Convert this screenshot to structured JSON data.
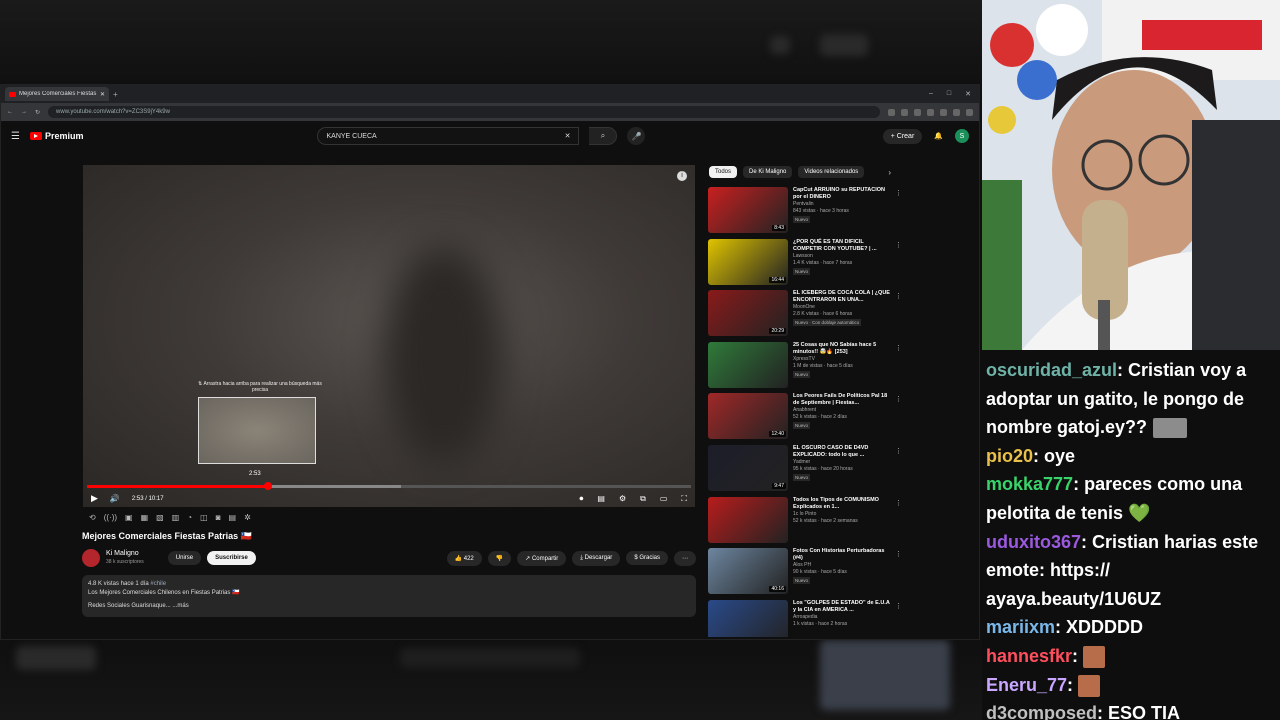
{
  "browser": {
    "tab_title": "Mejores Comerciales Fiestas Patrias",
    "url": "www.youtube.com/watch?v=ZC3S9jY4k9w",
    "window_controls": [
      "–",
      "□",
      "✕"
    ]
  },
  "youtube": {
    "logo_text": "Premium",
    "search_value": "KANYE CUECA",
    "create_label": "Crear",
    "avatar_letter": "S"
  },
  "player": {
    "seek_hint": "⇅ Arrastra hacia arriba para realizar una búsqueda más precisa",
    "preview_time": "2:53",
    "time_display": "2:53 / 10:17",
    "progress_fraction": 0.3,
    "buffered_fraction": 0.52
  },
  "video": {
    "title": "Mejores Comerciales Fiestas Patrias 🇨🇱",
    "channel": "Ki Maligno",
    "subscribers": "38 k suscriptores",
    "join_label": "Unirse",
    "subscribe_label": "Suscribirse",
    "likes": "422",
    "share_label": "Compartir",
    "download_label": "Descargar",
    "thanks_label": "Gracias",
    "desc_stats": "4.8 K vistas  hace 1 día",
    "desc_tag": "#chile",
    "desc_line1": "Los Mejores Comerciales Chilenos en Fiestas Patrias 🇨🇱",
    "desc_line2": "Redes Sociales Guarisnaque...",
    "desc_more": "...más"
  },
  "chips": [
    "Todos",
    "De Ki Maligno",
    "Videos relacionados"
  ],
  "recommendations": [
    {
      "title": "CapCut ARRUINO su REPUTACION por el DINERO",
      "channel": "Pentvalin",
      "meta": "843 vistas · hace 3 horas",
      "badge": "Nuevo",
      "duration": "8:43",
      "color": "#c92020"
    },
    {
      "title": "¿POR QUÉ ES TAN DIFICIL COMPETIR CON YOUTUBE? | ...",
      "channel": "Lawsson",
      "meta": "1.4 K vistas · hace 7 horas",
      "badge": "Nuevo",
      "duration": "16:44",
      "color": "#e0c400"
    },
    {
      "title": "EL ICEBERG DE COCA COLA | ¿QUE ENCONTRARON EN UNA...",
      "channel": "MoonOne",
      "meta": "2.8 K vistas · hace 6 horas",
      "badge": "Nuevo · Con doblaje automático",
      "duration": "20:29",
      "color": "#8a1a1a"
    },
    {
      "title": "25 Cosas que NO Sabías hace 5 minutos!! 🤯🔥 [253]",
      "channel": "XpressTV",
      "meta": "1 M de vistas · hace 5 días",
      "badge": "Nuevo",
      "duration": "",
      "color": "#2f7a3a"
    },
    {
      "title": "Los Peores Fails De Políticos Pal 18 de Septiembre | Fiestas...",
      "channel": "Anabhrent",
      "meta": "52 k vistas · hace 2 días",
      "badge": "Nuevo",
      "duration": "12:40",
      "color": "#a02828"
    },
    {
      "title": "EL OSCURO CASO DE D4VD EXPLICADO: todo lo que ...",
      "channel": "Yadmer",
      "meta": "95 k vistas · hace 20 horas",
      "badge": "Nuevo",
      "duration": "9:47",
      "color": "#1d1d2a"
    },
    {
      "title": "Todos los Tipos de COMUNISMO Explicados en 1...",
      "channel": "1c lo Pinto",
      "meta": "52 k vistas · hace 2 semanas",
      "badge": "",
      "duration": "",
      "color": "#b81c1c"
    },
    {
      "title": "Fotos Con Historias Perturbadoras (#4)",
      "channel": "Alos PH",
      "meta": "90 k vistas · hace 5 días",
      "badge": "Nuevo",
      "duration": "40:16",
      "color": "#6d86a0"
    },
    {
      "title": "Los \"GOLPES DE ESTADO\" de E.U.A y la CIA en AMERICA ...",
      "channel": "Arroapedia",
      "meta": "1 k vistas · hace 2 horas",
      "badge": "",
      "duration": "",
      "color": "#2a4a8a"
    }
  ],
  "chat": [
    {
      "user": "oscuridad_azul",
      "color": "#6fb3a8",
      "text": "Cristian voy a adoptar un gatito, le pongo de nombre gatoj.ey??",
      "emote": "cat-emote"
    },
    {
      "user": "pio20",
      "color": "#e8c04a",
      "text": "oye",
      "emote": ""
    },
    {
      "user": "mokka777",
      "color": "#39d36b",
      "text": "pareces como una pelotita de tenis 💚",
      "emote": ""
    },
    {
      "user": "uduxito367",
      "color": "#9b59e0",
      "text": "Cristian harias este emote: https:// ayaya.beauty/1U6UZ",
      "emote": ""
    },
    {
      "user": "mariixm",
      "color": "#7ab8ea",
      "text": "XDDDDD",
      "emote": ""
    },
    {
      "user": "hannesfkr",
      "color": "#ff4f5e",
      "text": "",
      "emote": "face-emote"
    },
    {
      "user": "Eneru_77",
      "color": "#c9a6ff",
      "text": "",
      "emote": "face-emote"
    },
    {
      "user": "d3composed",
      "color": "#c0c0c0",
      "text": "ESO TIA",
      "emote": ""
    }
  ]
}
